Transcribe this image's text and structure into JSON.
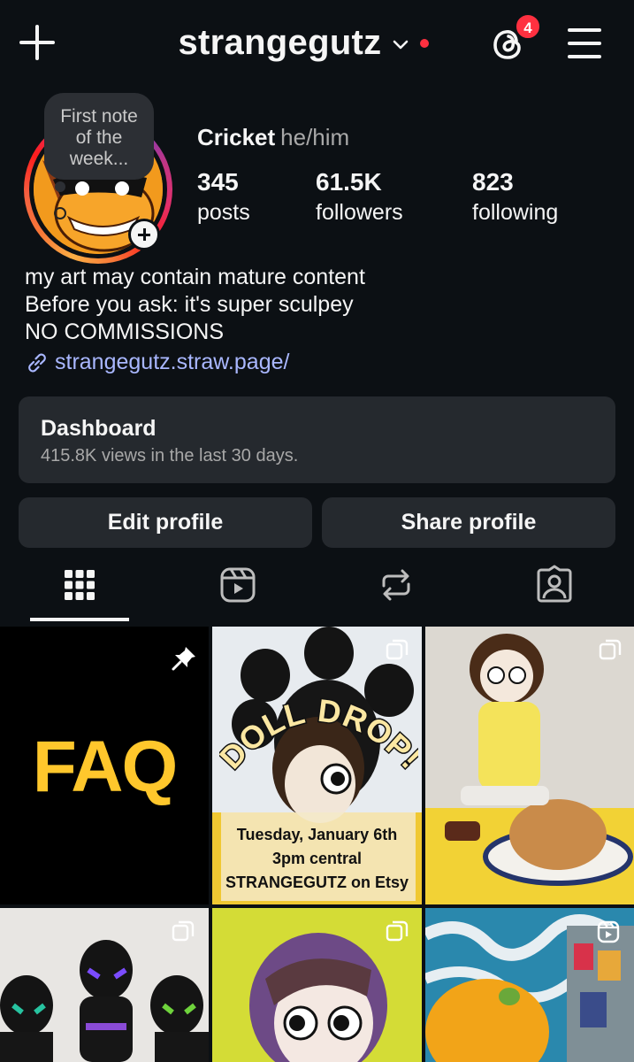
{
  "header": {
    "username": "strangegutz",
    "threads_badge_count": "4",
    "icons": [
      "plus-icon",
      "chevron-down-icon",
      "threads-icon",
      "menu-icon"
    ]
  },
  "note": {
    "text_line1": "First note",
    "text_line2": "of the",
    "text_line3": "week..."
  },
  "profile": {
    "name": "Cricket",
    "pronouns": "he/him",
    "stats": [
      {
        "value": "345",
        "label": "posts"
      },
      {
        "value": "61.5K",
        "label": "followers"
      },
      {
        "value": "823",
        "label": "following"
      }
    ],
    "bio_lines": [
      "my art may contain mature content",
      "Before you ask: it's super sculpey",
      "NO COMMISSIONS"
    ],
    "link": "strangegutz.straw.page/"
  },
  "dashboard": {
    "title": "Dashboard",
    "subtitle": "415.8K views in the last 30 days."
  },
  "buttons": {
    "edit": "Edit profile",
    "share": "Share profile"
  },
  "tabs": [
    "grid-icon",
    "reels-icon",
    "reposts-icon",
    "tagged-icon"
  ],
  "grid": {
    "faq_text": "FAQ",
    "doll_drop": {
      "banner": "DOLL DROP!",
      "line1": "Tuesday, January 6th",
      "line2": "3pm central",
      "line3": "STRANGEGUTZ on Etsy"
    }
  },
  "colors": {
    "background": "#0c1014",
    "surface": "#25292e",
    "link": "#a9b7ff",
    "badge": "#ff3040",
    "faq_yellow": "#ffc72c"
  }
}
